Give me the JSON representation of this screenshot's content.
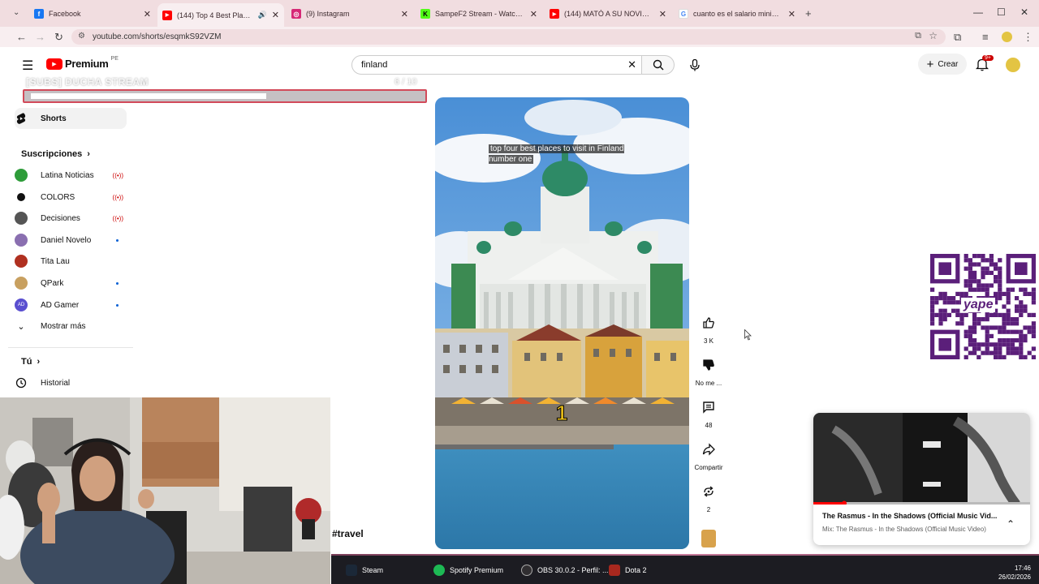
{
  "browser": {
    "tabs": [
      {
        "title": "Facebook",
        "favicon_color": "#1877f2",
        "favicon_glyph": "f"
      },
      {
        "title": "(144) Top 4 Best Places to V",
        "favicon_color": "#ff0000",
        "favicon_glyph": "▶",
        "active": true
      },
      {
        "title": "(9) Instagram",
        "favicon_color": "#d62976",
        "favicon_glyph": "◎"
      },
      {
        "title": "SampeF2 Stream - Watch Live o",
        "favicon_color": "#53fc18",
        "favicon_glyph": "K"
      },
      {
        "title": "(144) MATÓ A SU NOVIO, LO C",
        "favicon_color": "#ff0000",
        "favicon_glyph": "▶"
      },
      {
        "title": "cuanto es el salario minimo en",
        "favicon_color": "#4285f4",
        "favicon_glyph": "G"
      }
    ],
    "url": "youtube.com/shorts/esqmkS92VZM"
  },
  "youtube": {
    "logo_text": "Premium",
    "logo_region": "PE",
    "search_value": "finland",
    "create_label": "Crear",
    "notifications_badge": "9+"
  },
  "sidebar": {
    "shorts_label": "Shorts",
    "subscriptions_header": "Suscripciones",
    "subscriptions": [
      {
        "name": "Latina Noticias",
        "avatar_color": "#2e9c3a",
        "status": "live"
      },
      {
        "name": "COLORS",
        "avatar_color": "#111111",
        "status": "live"
      },
      {
        "name": "Decisiones",
        "avatar_color": "#555555",
        "status": "live"
      },
      {
        "name": "Daniel Novelo",
        "avatar_color": "#8a6fb0",
        "status": "new"
      },
      {
        "name": "Tita Lau",
        "avatar_color": "#b03020",
        "status": "none"
      },
      {
        "name": "QPark",
        "avatar_color": "#c8a060",
        "status": "new"
      },
      {
        "name": "AD Gamer",
        "avatar_color": "#5a4fd0",
        "status": "new",
        "avatar_text": "AD"
      }
    ],
    "show_more_label": "Mostrar más",
    "you_header": "Tú",
    "history_label": "Historial"
  },
  "overlay": {
    "title": "[SUBS] DUCHA STREAM",
    "count": "6 / 10"
  },
  "short": {
    "caption": "top four best places to visit in Finland number one",
    "number_overlay": "1",
    "hashtag": "#travel",
    "likes": "3 K",
    "dislike_label": "No me ...",
    "comments": "48",
    "share_label": "Compartir",
    "remix_count": "2"
  },
  "qr": {
    "brand": "yape",
    "color": "#5b1f7a"
  },
  "miniplayer": {
    "title": "The Rasmus - In the Shadows (Official Music Vid...",
    "subtitle": "Mix: The Rasmus - In the Shadows (Official Music Video)"
  },
  "taskbar": {
    "items": [
      {
        "label": "Steam",
        "icon_color": "#1b2838"
      },
      {
        "label": "Spotify Premium",
        "icon_color": "#1db954"
      },
      {
        "label": "OBS 30.0.2 - Perfil: ...",
        "icon_color": "#302e31"
      },
      {
        "label": "Dota 2",
        "icon_color": "#a8281e"
      }
    ],
    "time": "17:46",
    "date": "26/02/2026"
  }
}
